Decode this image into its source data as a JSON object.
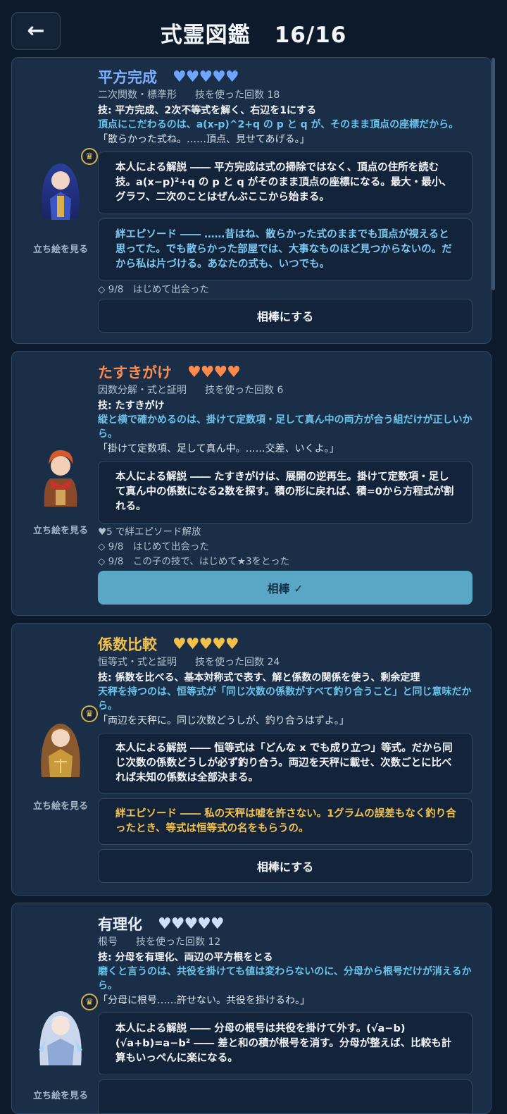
{
  "header": {
    "back_label": "←",
    "title": "式霊図鑑",
    "count": "16/16"
  },
  "cards": [
    {
      "name": "平方完成",
      "name_color": "#7fb0ff",
      "hearts": "♥♥♥♥♥",
      "heart_color": "#6ea6ff",
      "category": "二次関数・標準形",
      "uses": "技を使った回数 18",
      "skill": "技: 平方完成、2次不等式を解く、右辺を1にする",
      "reason": "頂点にこだわるのは、a(x-p)^2+q の p と q が、そのまま頂点の座標だから。",
      "quote": "「散らかった式ね。……頂点、見せてあげる。」",
      "explanation": "本人による解説 ―― 平方完成は式の掃除ではなく、頂点の住所を読む技。a(x−p)²+q の p と q がそのまま頂点の座標になる。最大・最小、グラフ、二次のことはぜんぶここから始まる。",
      "episode": "絆エピソード ―― ……昔はね、散らかった式のままでも頂点が視えると思ってた。でも散らかった部屋では、大事なものほど見つからないの。だから私は片づける。あなたの式も、いつでも。",
      "notes": [
        "◇ 9/8　はじめて出会った"
      ],
      "view_label": "立ち絵を見る",
      "button": "相棒にする",
      "avatar": "blue-hair-girl-portrait"
    },
    {
      "name": "たすきがけ",
      "name_color": "#ff8a4c",
      "hearts": "♥♥♥♥",
      "heart_color": "#ff8a4c",
      "category": "因数分解・式と証明",
      "uses": "技を使った回数 6",
      "skill": "技: たすきがけ",
      "reason": "縦と横で確かめるのは、掛けて定数項・足して真ん中の両方が合う組だけが正しいから。",
      "quote": "「掛けて定数項、足して真ん中。……交差、いくよ。」",
      "explanation": "本人による解説 ―― たすきがけは、展開の逆再生。掛けて定数項・足して真ん中の係数になる2数を探す。積の形に戻れば、積=0から方程式が割れる。",
      "notes": [
        "♥5 で絆エピソード解放",
        "◇ 9/8　はじめて出会った",
        "◇ 9/8　この子の技で、はじめて★3をとった"
      ],
      "view_label": "立ち絵を見る",
      "button": "相棒 ✓",
      "avatar": "red-hair-boy-portrait"
    },
    {
      "name": "係数比較",
      "name_color": "#f1c14c",
      "hearts": "♥♥♥♥♥",
      "heart_color": "#f1c14c",
      "category": "恒等式・式と証明",
      "uses": "技を使った回数 24",
      "skill": "技: 係数を比べる、基本対称式で表す、解と係数の関係を使う、剰余定理",
      "reason": "天秤を持つのは、恒等式が「同じ次数の係数がすべて釣り合うこと」と同じ意味だから。",
      "quote": "「両辺を天秤に。同じ次数どうしが、釣り合うはずよ。」",
      "explanation": "本人による解説 ―― 恒等式は「どんな x でも成り立つ」等式。だから同じ次数の係数どうしが必ず釣り合う。両辺を天秤に載せ、次数ごとに比べれば未知の係数は全部決まる。",
      "episode": "絆エピソード ―― 私の天秤は嘘を許さない。1グラムの誤差もなく釣り合ったとき、等式は恒等式の名をもらうの。",
      "view_label": "立ち絵を見る",
      "button": "相棒にする",
      "avatar": "brown-hair-girl-portrait"
    },
    {
      "name": "有理化",
      "name_color": "#e8eef6",
      "hearts": "♥♥♥♥♥",
      "heart_color": "#cfe0ff",
      "category": "根号",
      "uses": "技を使った回数 12",
      "skill": "技: 分母を有理化、両辺の平方根をとる",
      "reason": "磨くと言うのは、共役を掛けても値は変わらないのに、分母から根号だけが消えるから。",
      "quote": "「分母に根号……許せない。共役を掛けるわ。」",
      "explanation": "本人による解説 ―― 分母の根号は共役を掛けて外す。(√a−b)(√a+b)=a−b² ―― 差と和の積が根号を消す。分母が整えば、比較も計算もいっぺんに楽になる。",
      "view_label": "立ち絵を見る",
      "avatar": "white-hair-girl-portrait"
    }
  ]
}
